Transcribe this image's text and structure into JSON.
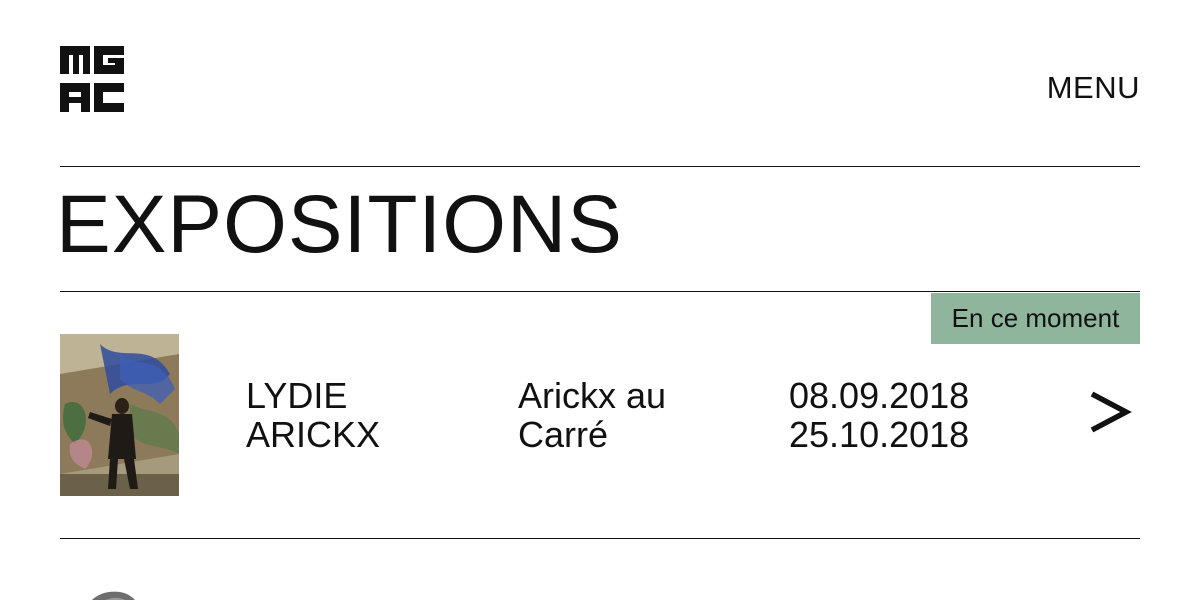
{
  "header": {
    "logo_alt": "MGAC",
    "menu_label": "MENU"
  },
  "page": {
    "title": "EXPOSITIONS"
  },
  "current": {
    "badge": "En ce moment",
    "badge_color": "#8fb59d"
  },
  "exhibitions": [
    {
      "artist_line1": "LYDIE",
      "artist_line2": "ARICKX",
      "title_line1": "Arickx au",
      "title_line2": "Carré",
      "start_date": "08.09.2018",
      "end_date": "25.10.2018",
      "arrow_icon": "chevron-right-icon"
    }
  ]
}
